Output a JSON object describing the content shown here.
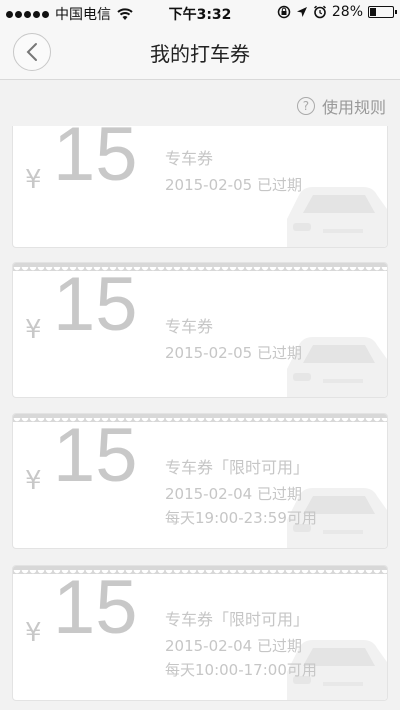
{
  "status_bar": {
    "carrier": "中国电信",
    "time": "下午3:32",
    "battery_percent": "28%",
    "battery_level": 0.28
  },
  "nav": {
    "title": "我的打车券"
  },
  "rules": {
    "label": "使用规则"
  },
  "coupons": [
    {
      "currency": "¥",
      "amount": "15",
      "type": "专车券",
      "date": "2015-02-05 已过期",
      "hours": ""
    },
    {
      "currency": "¥",
      "amount": "15",
      "type": "专车券",
      "date": "2015-02-05 已过期",
      "hours": ""
    },
    {
      "currency": "¥",
      "amount": "15",
      "type": "专车券「限时可用」",
      "date": "2015-02-04 已过期",
      "hours": "每天19:00-23:59可用"
    },
    {
      "currency": "¥",
      "amount": "15",
      "type": "专车券「限时可用」",
      "date": "2015-02-04 已过期",
      "hours": "每天10:00-17:00可用"
    }
  ]
}
